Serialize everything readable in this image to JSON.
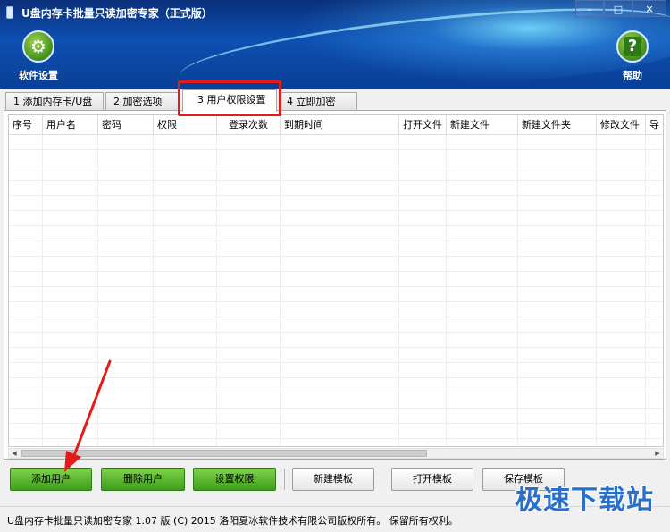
{
  "window": {
    "title": "U盘内存卡批量只读加密专家（正式版）",
    "controls": {
      "minimize": "–",
      "maximize": "□",
      "close": "✕"
    }
  },
  "toolbar": {
    "settings_label": "软件设置",
    "settings_icon": "gear-icon",
    "help_label": "帮助",
    "help_icon": "question-icon"
  },
  "tabs": [
    {
      "label": "1 添加内存卡/U盘"
    },
    {
      "label": "2 加密选项"
    },
    {
      "label": "3 用户权限设置"
    },
    {
      "label": "4 立即加密"
    }
  ],
  "active_tab": 2,
  "grid": {
    "columns": [
      "序号",
      "用户名",
      "密码",
      "权限",
      "登录次数",
      "到期时间",
      "打开文件",
      "新建文件",
      "新建文件夹",
      "修改文件",
      "导"
    ],
    "rows": []
  },
  "buttons": {
    "add_user": "添加用户",
    "delete_user": "删除用户",
    "set_permission": "设置权限",
    "new_template": "新建模板",
    "open_template": "打开模板",
    "save_template": "保存模板"
  },
  "status_bar": {
    "text": "U盘内存卡批量只读加密专家 1.07 版  (C)  2015 洛阳夏冰软件技术有限公司版权所有。 保留所有权利。"
  },
  "watermark": "极速下载站",
  "colors": {
    "header": "#0d4fb2",
    "green_button": "#3e9e1c",
    "highlight": "#e21b1b",
    "watermark": "#2a6fc9"
  }
}
